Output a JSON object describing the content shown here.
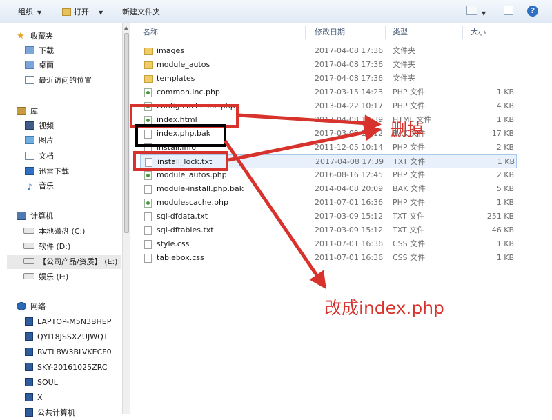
{
  "toolbar": {
    "organize": "组织",
    "open": "打开",
    "new_folder": "新建文件夹"
  },
  "nav": {
    "favorites": "收藏夹",
    "downloads": "下载",
    "desktop": "桌面",
    "recent": "最近访问的位置",
    "libraries": "库",
    "videos": "视频",
    "pictures": "图片",
    "documents": "文档",
    "thunder": "迅雷下载",
    "music": "音乐",
    "computer": "计算机",
    "drive_c": "本地磁盘 (C:)",
    "drive_d": "软件 (D:)",
    "drive_e": "【公司产品/资质】 (E:)",
    "drive_f": "娱乐 (F:)",
    "network": "网络",
    "pcs": [
      "LAPTOP-M5N3BHEP",
      "QYI18JSSXZUJWQT",
      "RVTLBW3BLVKECF0",
      "SKY-20161025ZRC",
      "SOUL",
      "X",
      "公共计算机"
    ]
  },
  "columns": {
    "name": "名称",
    "date": "修改日期",
    "type": "类型",
    "size": "大小"
  },
  "files": [
    {
      "name": "images",
      "date": "2017-04-08 17:36",
      "type": "文件夹",
      "size": "",
      "icon": "folder-icon"
    },
    {
      "name": "module_autos",
      "date": "2017-04-08 17:36",
      "type": "文件夹",
      "size": "",
      "icon": "folder-icon"
    },
    {
      "name": "templates",
      "date": "2017-04-08 17:36",
      "type": "文件夹",
      "size": "",
      "icon": "folder-icon"
    },
    {
      "name": "common.inc.php",
      "date": "2017-03-15 14:23",
      "type": "PHP 文件",
      "size": "1 KB",
      "icon": "php-file-icon"
    },
    {
      "name": "config.cache.inc.php",
      "date": "2013-04-22 10:17",
      "type": "PHP 文件",
      "size": "4 KB",
      "icon": "php-file-icon"
    },
    {
      "name": "index.html",
      "date": "2017-04-08 17:39",
      "type": "HTML 文件",
      "size": "1 KB",
      "icon": "html-file-icon"
    },
    {
      "name": "index.php.bak",
      "date": "2017-03-09 15:12",
      "type": "BAK 文件",
      "size": "17 KB",
      "icon": "text-file-icon"
    },
    {
      "name": "install.info",
      "date": "2011-12-05 10:14",
      "type": "PHP 文件",
      "size": "2 KB",
      "icon": "text-file-icon"
    },
    {
      "name": "install_lock.txt",
      "date": "2017-04-08 17:39",
      "type": "TXT 文件",
      "size": "1 KB",
      "icon": "text-file-icon"
    },
    {
      "name": "module_autos.php",
      "date": "2016-08-16 12:45",
      "type": "PHP 文件",
      "size": "2 KB",
      "icon": "php-file-icon"
    },
    {
      "name": "module-install.php.bak",
      "date": "2014-04-08 20:09",
      "type": "BAK 文件",
      "size": "5 KB",
      "icon": "text-file-icon"
    },
    {
      "name": "modulescache.php",
      "date": "2011-07-01 16:36",
      "type": "PHP 文件",
      "size": "1 KB",
      "icon": "php-file-icon"
    },
    {
      "name": "sql-dfdata.txt",
      "date": "2017-03-09 15:12",
      "type": "TXT 文件",
      "size": "251 KB",
      "icon": "text-file-icon"
    },
    {
      "name": "sql-dftables.txt",
      "date": "2017-03-09 15:12",
      "type": "TXT 文件",
      "size": "46 KB",
      "icon": "text-file-icon"
    },
    {
      "name": "style.css",
      "date": "2011-07-01 16:36",
      "type": "CSS 文件",
      "size": "1 KB",
      "icon": "text-file-icon"
    },
    {
      "name": "tablebox.css",
      "date": "2011-07-01 16:36",
      "type": "CSS 文件",
      "size": "1 KB",
      "icon": "text-file-icon"
    }
  ],
  "annotations": {
    "delete_label": "删掉",
    "rename_label": "改成index.php",
    "red": "#d8322d",
    "black": "#000000"
  }
}
